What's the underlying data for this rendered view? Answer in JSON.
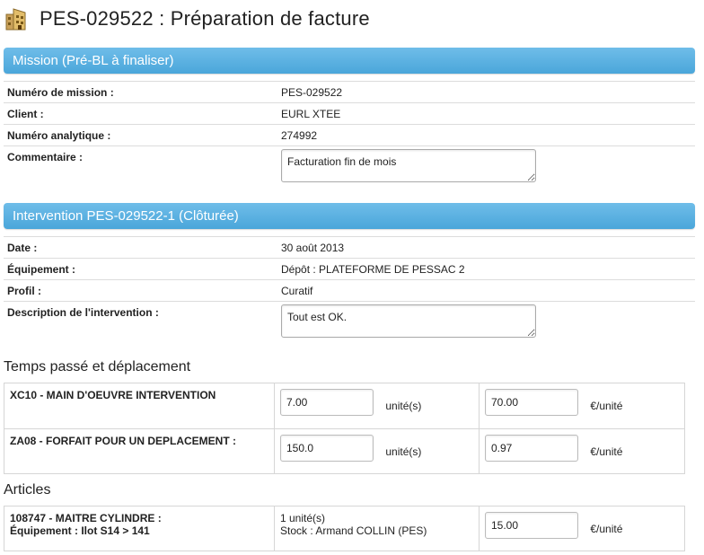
{
  "header": {
    "title": "PES-029522 : Préparation de facture",
    "icon": "building-icon"
  },
  "mission": {
    "section_title": "Mission (Pré-BL à finaliser)",
    "rows": [
      {
        "label": "Numéro de mission :",
        "value": "PES-029522"
      },
      {
        "label": "Client :",
        "value": "EURL XTEE"
      },
      {
        "label": "Numéro analytique :",
        "value": "274992"
      }
    ],
    "comment_label": "Commentaire :",
    "comment_value": "Facturation fin de mois"
  },
  "intervention": {
    "section_title": "Intervention PES-029522-1 (Clôturée)",
    "rows": [
      {
        "label": "Date :",
        "value": "30 août 2013"
      },
      {
        "label": "Équipement :",
        "value": "Dépôt : PLATEFORME DE PESSAC 2"
      },
      {
        "label": "Profil :",
        "value": "Curatif"
      }
    ],
    "description_label": "Description de l'intervention :",
    "description_value": "Tout est OK."
  },
  "time_section": {
    "title": "Temps passé et déplacement",
    "items": [
      {
        "label": "XC10 - MAIN D'OEUVRE INTERVENTION",
        "quantity": "7.00",
        "quantity_unit": "unité(s)",
        "price": "70.00",
        "price_unit": "€/unité"
      },
      {
        "label": "ZA08 - FORFAIT POUR UN DEPLACEMENT :",
        "quantity": "150.0",
        "quantity_unit": "unité(s)",
        "price": "0.97",
        "price_unit": "€/unité"
      }
    ]
  },
  "articles": {
    "title": "Articles",
    "items": [
      {
        "label_line1": "108747 - MAITRE CYLINDRE :",
        "label_line2": "Équipement : Ilot S14 > 141",
        "quantity_line1": "1 unité(s)",
        "quantity_line2": "Stock : Armand COLLIN (PES)",
        "price": "15.00",
        "price_unit": "€/unité"
      }
    ]
  },
  "colors": {
    "section_header_bg": "#4aa6da",
    "section_header_text": "#ffffff"
  }
}
